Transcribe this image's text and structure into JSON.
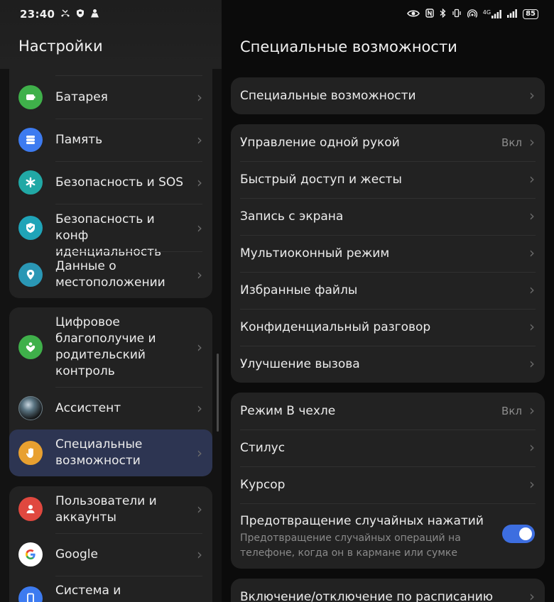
{
  "status_bar": {
    "time": "23:40",
    "battery": "85",
    "left_icons": [
      "missed-call-icon",
      "shield-icon",
      "vpn-icon"
    ],
    "right_icons": [
      "eye-icon",
      "nfc-icon",
      "bluetooth-icon",
      "vibrate-icon",
      "hotspot-icon",
      "signal-4g-icon",
      "signal-bars-icon"
    ],
    "network_label": "4G"
  },
  "left": {
    "title": "Настройки",
    "card1": [
      {
        "label": "Батарея",
        "icon": "battery-icon",
        "color": "#3fb04a"
      },
      {
        "label": "Память",
        "icon": "storage-icon",
        "color": "#3d7bf0"
      },
      {
        "label": "Безопасность и SOS",
        "icon": "asterisk-icon",
        "color": "#21a8a5"
      },
      {
        "label": "Безопасность и конф\nиденциальность",
        "icon": "shield-check-icon",
        "color": "#1fa4b8"
      },
      {
        "label": "Данные о\nместоположении",
        "icon": "location-icon",
        "color": "#2a97b5"
      }
    ],
    "card2": [
      {
        "label": "Цифровое\nблагополучие и\nродительский\nконтроль",
        "icon": "wellbeing-icon",
        "color": "#3fb04a"
      },
      {
        "label": "Ассистент",
        "icon": "assistant-orb-icon",
        "color": "#1c2a33"
      },
      {
        "label": "Специальные\nвозможности",
        "icon": "hand-icon",
        "color": "#e8a030"
      }
    ],
    "card3": [
      {
        "label": "Пользователи и\nаккаунты",
        "icon": "user-icon",
        "color": "#e0483f"
      },
      {
        "label": "Google",
        "icon": "google-icon",
        "color": "#ffffff"
      },
      {
        "label": "Система и",
        "icon": "system-icon",
        "color": "#3d7bf0"
      }
    ]
  },
  "right": {
    "title": "Специальные возможности",
    "card1": [
      {
        "label": "Специальные возможности",
        "value": ""
      }
    ],
    "card2": [
      {
        "label": "Управление одной рукой",
        "value": "Вкл"
      },
      {
        "label": "Быстрый доступ и жесты",
        "value": ""
      },
      {
        "label": "Запись с экрана",
        "value": ""
      },
      {
        "label": "Мультиоконный режим",
        "value": ""
      },
      {
        "label": "Избранные файлы",
        "value": ""
      },
      {
        "label": "Конфиденциальный разговор",
        "value": ""
      },
      {
        "label": "Улучшение вызова",
        "value": ""
      }
    ],
    "card3": [
      {
        "label": "Режим В чехле",
        "value": "Вкл"
      },
      {
        "label": "Стилус",
        "value": ""
      },
      {
        "label": "Курсор",
        "value": ""
      },
      {
        "label": "Предотвращение случайных нажатий",
        "sub": "Предотвращение случайных операций на телефоне, когда он в кармане или сумке",
        "toggle": true
      }
    ],
    "card4": [
      {
        "label": "Включение/отключение по расписанию",
        "value": ""
      }
    ]
  },
  "colors": {
    "accent": "#3d6ee0",
    "highlight": "#2d3552",
    "card": "#222222"
  }
}
